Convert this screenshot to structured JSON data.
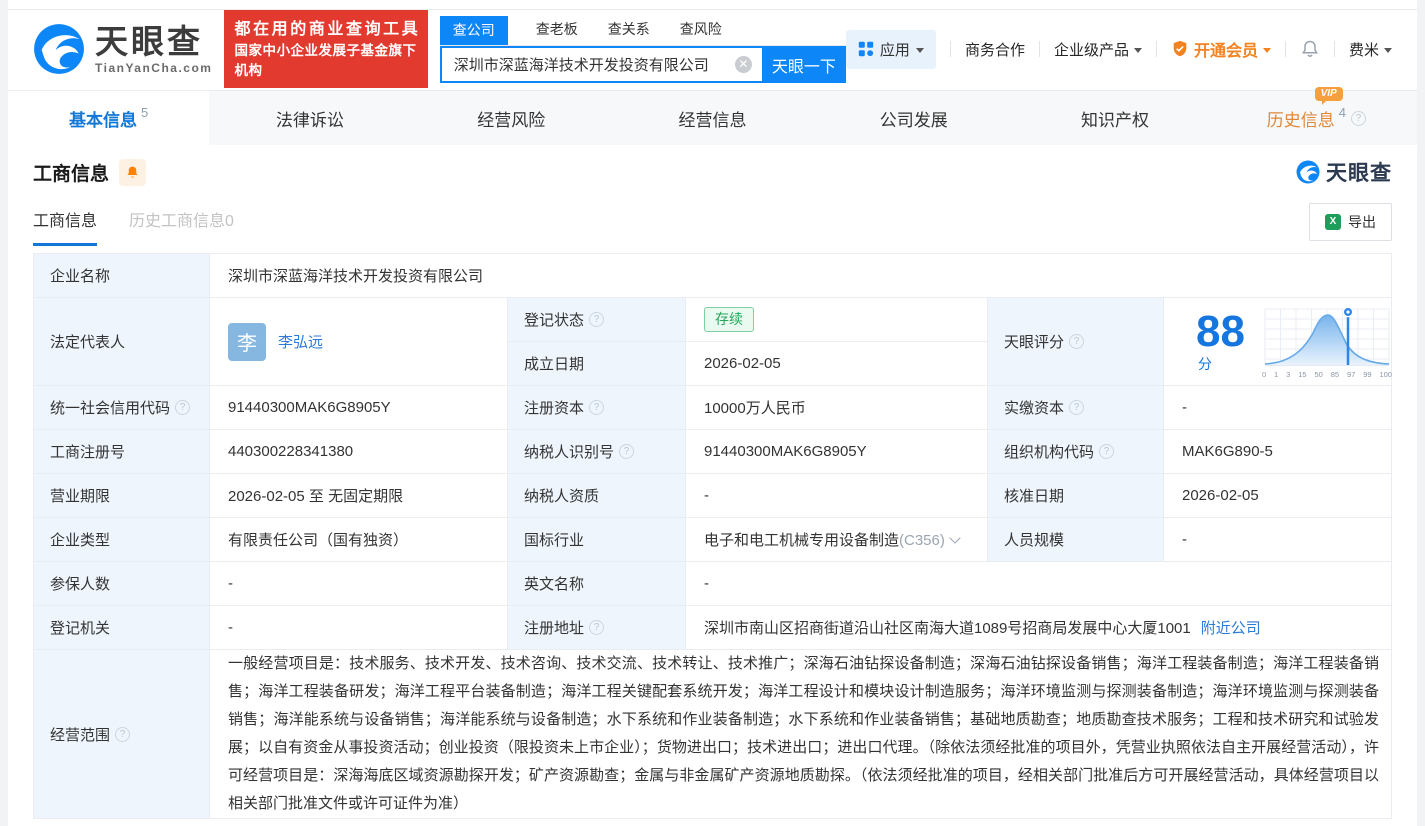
{
  "brand": {
    "name": "天眼查",
    "domain": "TianYanCha.com",
    "slogan_line1": "都在用的商业查询工具",
    "slogan_line2": "国家中小企业发展子基金旗下机构"
  },
  "search": {
    "tabs": [
      {
        "label": "查公司",
        "active": true
      },
      {
        "label": "查老板",
        "active": false
      },
      {
        "label": "查关系",
        "active": false
      },
      {
        "label": "查风险",
        "active": false
      }
    ],
    "value": "深圳市深蓝海洋技术开发投资有限公司",
    "button_label": "天眼一下"
  },
  "top_nav": {
    "apps_label": "应用",
    "cooperation_label": "商务合作",
    "enterprise_label": "企业级产品",
    "vip_label": "开通会员",
    "username": "费米"
  },
  "page_tabs": [
    {
      "label": "基本信息",
      "count": "5",
      "active": true
    },
    {
      "label": "法律诉讼"
    },
    {
      "label": "经营风险"
    },
    {
      "label": "经营信息"
    },
    {
      "label": "公司发展"
    },
    {
      "label": "知识产权"
    },
    {
      "label": "历史信息",
      "count": "4",
      "vip": true
    }
  ],
  "section": {
    "title": "工商信息",
    "watermark_brand": "天眼查",
    "vip_badge": "VIP",
    "subtabs": [
      {
        "label": "工商信息",
        "active": true
      },
      {
        "label": "历史工商信息0",
        "active": false
      }
    ],
    "export_label": "导出"
  },
  "table": {
    "company_name": {
      "label": "企业名称",
      "value": "深圳市深蓝海洋技术开发投资有限公司"
    },
    "legal_rep": {
      "label": "法定代表人",
      "avatar_char": "李",
      "name": "李弘远"
    },
    "reg_status": {
      "label": "登记状态",
      "value": "存续"
    },
    "establish_date": {
      "label": "成立日期",
      "value": "2026-02-05"
    },
    "score": {
      "label": "天眼评分",
      "value": "88",
      "unit": "分"
    },
    "credit_code": {
      "label": "统一社会信用代码",
      "value": "91440300MAK6G8905Y"
    },
    "reg_capital": {
      "label": "注册资本",
      "value": "10000万人民币"
    },
    "paid_capital": {
      "label": "实缴资本",
      "value": "-"
    },
    "reg_number": {
      "label": "工商注册号",
      "value": "440300228341380"
    },
    "taxpayer_id": {
      "label": "纳税人识别号",
      "value": "91440300MAK6G8905Y"
    },
    "org_code": {
      "label": "组织机构代码",
      "value": "MAK6G890-5"
    },
    "business_term": {
      "label": "营业期限",
      "value": "2026-02-05 至 无固定期限"
    },
    "taxpayer_quality": {
      "label": "纳税人资质",
      "value": "-"
    },
    "approval_date": {
      "label": "核准日期",
      "value": "2026-02-05"
    },
    "company_type": {
      "label": "企业类型",
      "value": "有限责任公司（国有独资）"
    },
    "industry": {
      "label": "国标行业",
      "value": "电子和电工机械专用设备制造",
      "code": "(C356)"
    },
    "staff_size": {
      "label": "人员规模",
      "value": "-"
    },
    "insured_count": {
      "label": "参保人数",
      "value": "-"
    },
    "english_name": {
      "label": "英文名称",
      "value": "-"
    },
    "reg_authority": {
      "label": "登记机关",
      "value": "-"
    },
    "address": {
      "label": "注册地址",
      "value": "深圳市南山区招商街道沿山社区南海大道1089号招商局发展中心大厦1001",
      "link": "附近公司"
    },
    "business_scope": {
      "label": "经营范围",
      "value": "一般经营项目是：技术服务、技术开发、技术咨询、技术交流、技术转让、技术推广；深海石油钻探设备制造；深海石油钻探设备销售；海洋工程装备制造；海洋工程装备销售；海洋工程装备研发；海洋工程平台装备制造；海洋工程关键配套系统开发；海洋工程设计和模块设计制造服务；海洋环境监测与探测装备制造；海洋环境监测与探测装备销售；海洋能系统与设备销售；海洋能系统与设备制造；水下系统和作业装备制造；水下系统和作业装备销售；基础地质勘查；地质勘查技术服务；工程和技术研究和试验发展；以自有资金从事投资活动；创业投资（限投资未上市企业）；货物进出口；技术进出口；进出口代理。（除依法须经批准的项目外，凭营业执照依法自主开展经营活动），许可经营项目是：深海海底区域资源勘探开发；矿产资源勘查；金属与非金属矿产资源地质勘探。（依法须经批准的项目，经相关部门批准后方可开展经营活动，具体经营项目以相关部门批准文件或许可证件为准）"
    }
  },
  "chart_data": {
    "type": "area",
    "title": "天眼评分",
    "score": 88,
    "score_unit": "分",
    "x_tick_labels": [
      "0",
      "1",
      "3",
      "15",
      "50",
      "85",
      "97",
      "99",
      "100"
    ],
    "marker_value": 88,
    "curve": "bell-shaped score percentile distribution, peak near tick 50, marker pin at score 88",
    "legend_position": "none",
    "grid": true
  },
  "colors": {
    "brand_blue": "#0d87f8",
    "link_blue": "#2c7bd9",
    "banner_red": "#e23a2e",
    "vip_orange": "#f58220",
    "history_orange": "#e0883a",
    "tag_green": "#26a65b",
    "score_blue": "#1576e0",
    "label_cell_bg": "#eff5fc",
    "table_border": "#e9edf2"
  }
}
